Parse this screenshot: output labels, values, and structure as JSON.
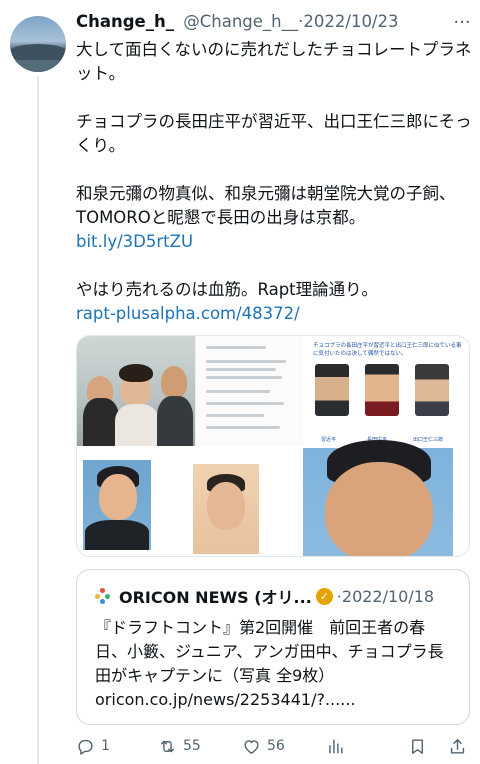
{
  "tweet": {
    "display_name": "Change_h_",
    "handle": "@Change_h__",
    "separator": "·",
    "date": "2022/10/23",
    "more_label": "···",
    "paragraph1": "大して面白くないのに売れだしたチョコレートプラネット。",
    "paragraph2": "チョコプラの長田庄平が習近平、出口王仁三郎にそっくり。",
    "paragraph3": "和泉元彌の物真似、和泉元彌は朝堂院大覚の子飼、TOMOROと昵懇で長田の出身は京都。",
    "link1": "bit.ly/3D5rtZU",
    "paragraph4": "やはり売れるのは血筋。Rapt理論通り。",
    "link2": "rapt-plusalpha.com/48372/"
  },
  "media": {
    "sheet_title": "チョコプラの長田庄平が習近平と出口王仁三郎に似ている事に気付いたのは決して偶然ではない。",
    "captions": [
      "習近平",
      "長田庄平",
      "出口王仁三郎"
    ]
  },
  "quote": {
    "source_name": "ORICON NEWS (オリ...",
    "separator": "·",
    "date": "2022/10/18",
    "text": "『ドラフトコント』第2回開催　前回王者の春日、小籔、ジュニア、アンガ田中、チョコプラ長田がキャプテンに（写真 全9枚）",
    "link": "oricon.co.jp/news/2253441/?......"
  },
  "actions": {
    "replies": "1",
    "retweets": "55",
    "likes": "56"
  },
  "icons": [
    "reply-icon",
    "retweet-icon",
    "like-icon",
    "views-icon",
    "bookmark-icon",
    "share-icon",
    "verified-icon",
    "ellipsis-icon"
  ],
  "colors": {
    "link": "#1d72b8",
    "muted": "#536471",
    "verified": "#e3a400"
  }
}
